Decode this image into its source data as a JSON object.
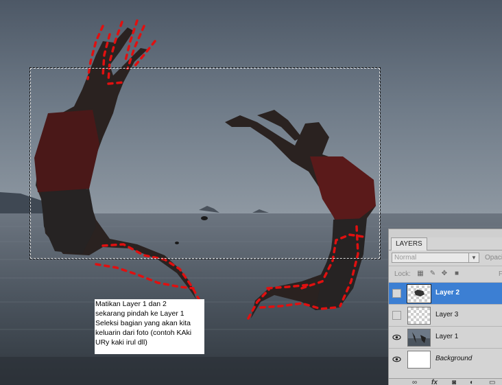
{
  "note": {
    "text": "Matikan Layer 1 dan 2\nsekarang pindah ke Layer 1\nSeleksi bagian yang akan kita\nkeluarin dari foto (contoh KAki\nURy kaki irul dll)"
  },
  "layers_panel": {
    "tab_label": "LAYERS",
    "blend_mode": "Normal",
    "opacity_label": "Opaci",
    "lock_label": "Lock:",
    "fill_label": "F",
    "layers": [
      {
        "name": "Layer 2",
        "visible": false,
        "selected": true
      },
      {
        "name": "Layer 3",
        "visible": false,
        "selected": false
      },
      {
        "name": "Layer 1",
        "visible": true,
        "selected": false
      },
      {
        "name": "Background",
        "visible": true,
        "selected": false
      }
    ],
    "bottom_icons": [
      "link-icon",
      "fx-icon",
      "mask-icon",
      "adjustment-icon",
      "new-group-icon"
    ]
  },
  "colors": {
    "selection_highlight": "#3c7fd3",
    "annotation_red": "#e01010",
    "sky": "#6d7987",
    "sea": "#4f5862"
  }
}
